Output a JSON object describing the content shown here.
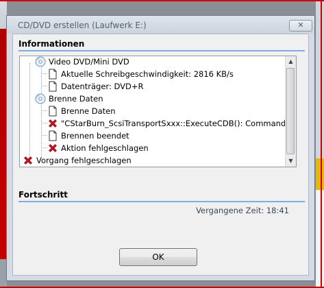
{
  "dialog": {
    "title": "CD/DVD erstellen (Laufwerk E:)",
    "close_glyph": "✕"
  },
  "info": {
    "header": "Informationen",
    "tree": [
      {
        "text": "Video DVD/Mini DVD",
        "icon": "disc-icon",
        "level": 0
      },
      {
        "text": "Aktuelle Schreibgeschwindigkeit: 2816 KB/s",
        "icon": "document-icon",
        "level": 1
      },
      {
        "text": "Datenträger: DVD+R",
        "icon": "document-icon",
        "level": 1
      },
      {
        "text": "Brenne Daten",
        "icon": "disc-icon",
        "level": 0
      },
      {
        "text": "Brenne Daten",
        "icon": "document-icon",
        "level": 1
      },
      {
        "text": "\"CStarBurn_ScsiTransportSxxx::ExecuteCDB(): Command failed\", exc",
        "icon": "error-x-icon",
        "level": 1
      },
      {
        "text": "Brennen beendet",
        "icon": "document-icon",
        "level": 1
      },
      {
        "text": "Aktion fehlgeschlagen",
        "icon": "error-x-icon",
        "level": 1
      },
      {
        "text": "Vorgang fehlgeschlagen",
        "icon": "error-x-icon",
        "level": 0
      }
    ]
  },
  "progress": {
    "header": "Fortschritt",
    "elapsed": "Vergangene Zeit: 18:41"
  },
  "buttons": {
    "ok": "OK"
  },
  "colors": {
    "section_line": "#7eaee0",
    "error_red": "#c8141e",
    "dialog_bg": "#d4dbe4"
  }
}
